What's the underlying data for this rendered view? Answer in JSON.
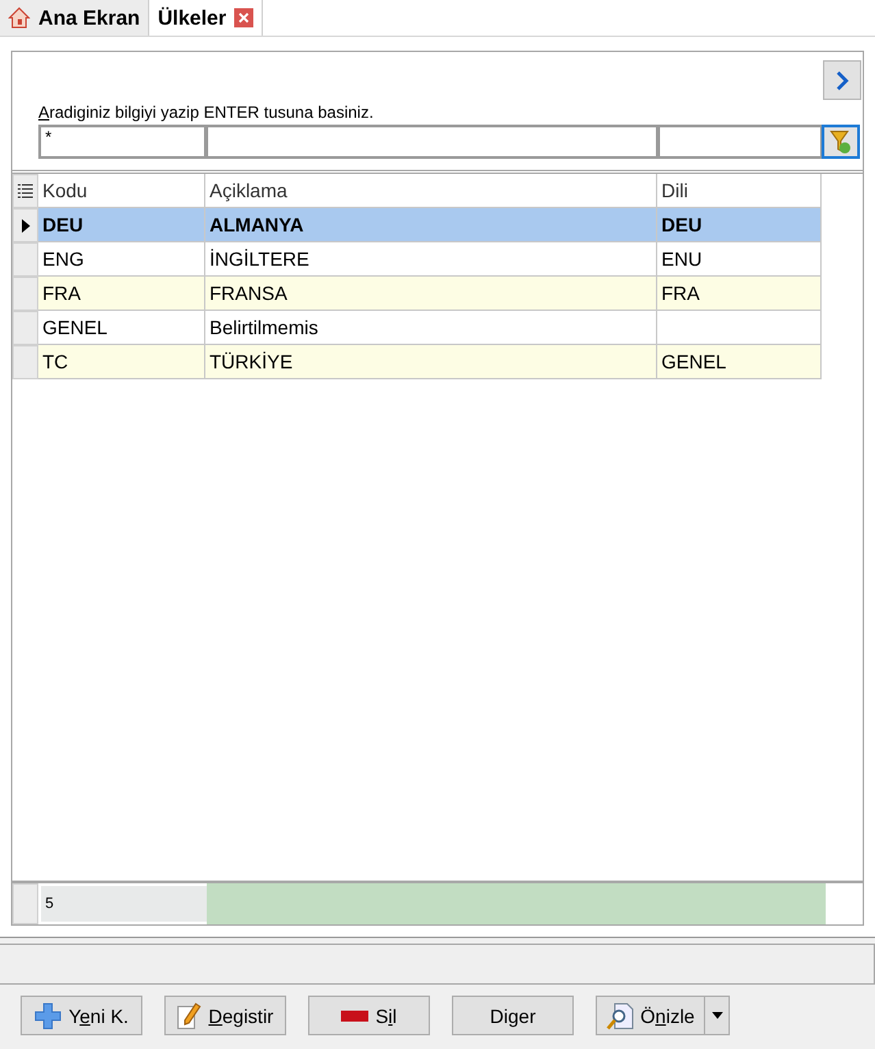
{
  "tabs": [
    {
      "label": "Ana Ekran",
      "kind": "home",
      "selected": false
    },
    {
      "label": "Ülkeler",
      "kind": "closable",
      "selected": true
    }
  ],
  "search": {
    "hint": {
      "key": "A",
      "post": "radiginiz bilgiyi yazip ENTER tusuna basiniz."
    },
    "filter_value": "*"
  },
  "table": {
    "columns": [
      "Kodu",
      "Açiklama",
      "Dili"
    ],
    "rows": [
      {
        "cells": [
          "DEU",
          "ALMANYA",
          "DEU"
        ],
        "selected": true
      },
      {
        "cells": [
          "ENG",
          "İNGİLTERE",
          "ENU"
        ],
        "selected": false
      },
      {
        "cells": [
          "FRA",
          "FRANSA",
          "FRA"
        ],
        "selected": false
      },
      {
        "cells": [
          "GENEL",
          "Belirtilmemis",
          null
        ],
        "selected": false
      },
      {
        "cells": [
          "TC",
          "TÜRKİYE",
          "GENEL"
        ],
        "selected": false
      }
    ],
    "count": "5"
  },
  "buttons": [
    {
      "kind": "new",
      "label": {
        "pre": "Y",
        "key": "e",
        "post": "ni K."
      }
    },
    {
      "kind": "edit",
      "label": {
        "key": "D",
        "post": "egistir"
      }
    },
    {
      "kind": "delete",
      "label": {
        "pre": "S",
        "key": "i",
        "post": "l"
      }
    },
    {
      "kind": "other",
      "label": {
        "pre": "Di",
        "key": "g",
        "post": "er"
      }
    },
    {
      "kind": "preview",
      "label": {
        "pre": "Ö",
        "key": "n",
        "post": "izle"
      }
    }
  ]
}
